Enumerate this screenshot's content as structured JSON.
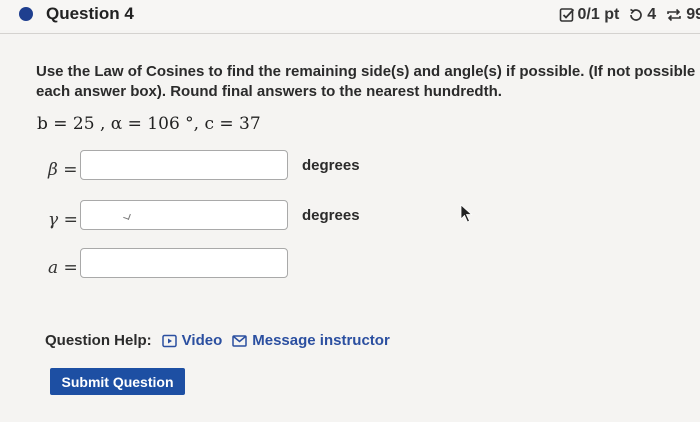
{
  "header": {
    "question_title": "Question 4",
    "score": "0/1 pt",
    "attempts": "4",
    "submissions": "99"
  },
  "prompt": {
    "line1": "Use the Law of Cosines to find the remaining side(s) and angle(s) if possible. (If not possible ente",
    "line2": "each answer box). Round final answers to the nearest hundredth."
  },
  "given": "b = 25 , α = 106 °, c = 37",
  "answers": [
    {
      "label": "β =",
      "value": "",
      "unit": "degrees"
    },
    {
      "label": "γ =",
      "value": "",
      "unit": "degrees"
    },
    {
      "label": "a =",
      "value": "",
      "unit": ""
    }
  ],
  "help": {
    "label": "Question Help:",
    "video": "Video",
    "message": "Message instructor"
  },
  "submit_label": "Submit Question",
  "colors": {
    "accent": "#1d4fa3",
    "link": "#2b4fa0",
    "dot": "#1f3f8f"
  }
}
